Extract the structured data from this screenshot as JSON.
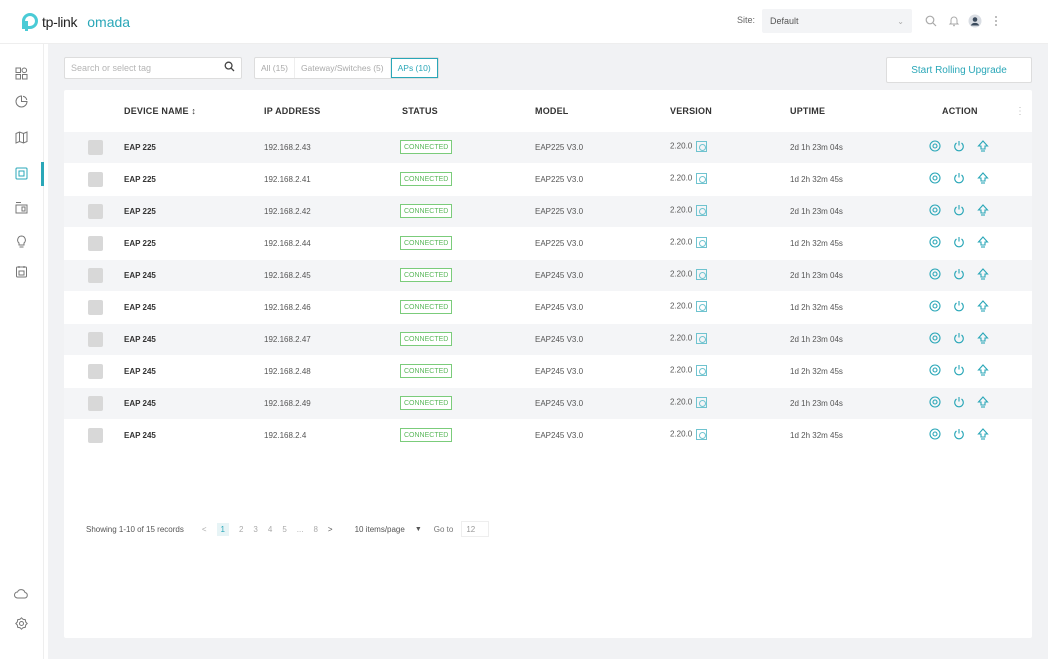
{
  "header": {
    "brand": "tp-link",
    "product": "omada",
    "site_label": "Site:",
    "site_value": "Default"
  },
  "toolbar": {
    "search_placeholder": "Search or select tag",
    "filters": [
      {
        "label": "All (15)",
        "active": false
      },
      {
        "label": "Gateway/Switches (5)",
        "active": false
      },
      {
        "label": "APs (10)",
        "active": true
      }
    ],
    "rolling_upgrade": "Start Rolling Upgrade"
  },
  "table": {
    "columns": [
      "DEVICE NAME ↕",
      "IP ADDRESS",
      "STATUS",
      "MODEL",
      "VERSION",
      "UPTIME",
      "ACTION"
    ],
    "rows": [
      {
        "name": "EAP 225",
        "ip": "192.168.2.43",
        "status": "CONNECTED",
        "model": "EAP225 V3.0",
        "version": "2.20.0",
        "uptime": "2d 1h 23m 04s"
      },
      {
        "name": "EAP 225",
        "ip": "192.168.2.41",
        "status": "CONNECTED",
        "model": "EAP225 V3.0",
        "version": "2.20.0",
        "uptime": "1d 2h 32m 45s"
      },
      {
        "name": "EAP 225",
        "ip": "192.168.2.42",
        "status": "CONNECTED",
        "model": "EAP225 V3.0",
        "version": "2.20.0",
        "uptime": "2d 1h 23m 04s"
      },
      {
        "name": "EAP 225",
        "ip": "192.168.2.44",
        "status": "CONNECTED",
        "model": "EAP225 V3.0",
        "version": "2.20.0",
        "uptime": "1d 2h 32m 45s"
      },
      {
        "name": "EAP 245",
        "ip": "192.168.2.45",
        "status": "CONNECTED",
        "model": "EAP245 V3.0",
        "version": "2.20.0",
        "uptime": "2d 1h 23m 04s"
      },
      {
        "name": "EAP 245",
        "ip": "192.168.2.46",
        "status": "CONNECTED",
        "model": "EAP245 V3.0",
        "version": "2.20.0",
        "uptime": "1d 2h 32m 45s"
      },
      {
        "name": "EAP 245",
        "ip": "192.168.2.47",
        "status": "CONNECTED",
        "model": "EAP245 V3.0",
        "version": "2.20.0",
        "uptime": "2d 1h 23m 04s"
      },
      {
        "name": "EAP 245",
        "ip": "192.168.2.48",
        "status": "CONNECTED",
        "model": "EAP245 V3.0",
        "version": "2.20.0",
        "uptime": "1d 2h 32m 45s"
      },
      {
        "name": "EAP 245",
        "ip": "192.168.2.49",
        "status": "CONNECTED",
        "model": "EAP245 V3.0",
        "version": "2.20.0",
        "uptime": "2d 1h 23m 04s"
      },
      {
        "name": "EAP 245",
        "ip": "192.168.2.4",
        "status": "CONNECTED",
        "model": "EAP245 V3.0",
        "version": "2.20.0",
        "uptime": "1d 2h 32m 45s"
      }
    ]
  },
  "pagination": {
    "summary": "Showing 1-10 of 15 records",
    "prev": "<",
    "pages": [
      "1",
      "2",
      "3",
      "4",
      "5",
      "...",
      "8"
    ],
    "next": ">",
    "per_page": "10 items/page",
    "goto_label": "Go to",
    "goto_value": "12"
  },
  "icons": {
    "sidebar_top": [
      "dashboard-icon",
      "statistics-icon",
      "map-icon",
      "devices-icon",
      "clients-icon",
      "insight-icon",
      "log-icon"
    ],
    "sidebar_bottom": [
      "cloud-icon",
      "settings-icon"
    ],
    "row_actions": [
      "locate-icon",
      "reboot-icon",
      "upgrade-icon"
    ]
  },
  "colors": {
    "accent": "#2aa7b8",
    "status_ok": "#5bb85b"
  }
}
